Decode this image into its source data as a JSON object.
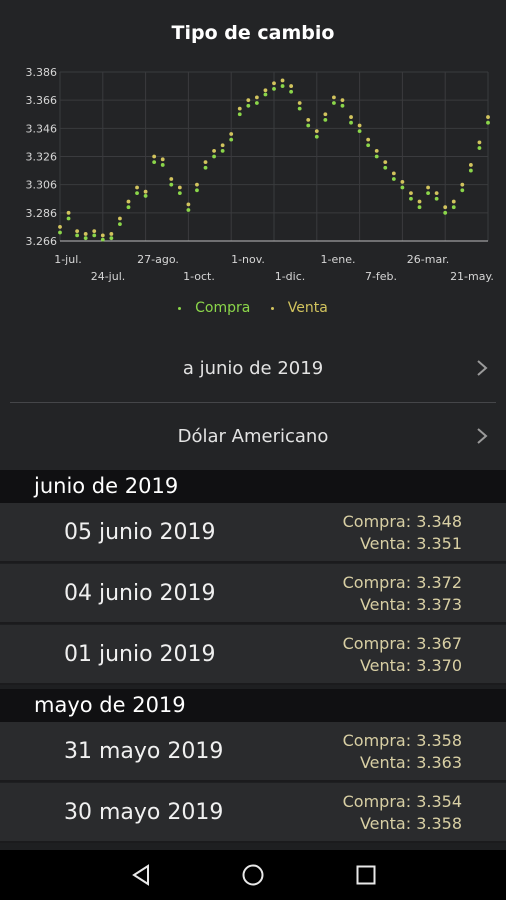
{
  "header": {
    "title": "Tipo de cambio"
  },
  "chart_data": {
    "type": "scatter",
    "ylim": [
      3.266,
      3.386
    ],
    "y_ticks": [
      "3.386",
      "3.366",
      "3.346",
      "3.326",
      "3.306",
      "3.286",
      "3.266"
    ],
    "x_ticks_top": [
      "1-jul.",
      "27-ago.",
      "1-nov.",
      "1-ene.",
      "26-mar."
    ],
    "x_ticks_bottom": [
      "24-jul.",
      "1-oct.",
      "1-dic.",
      "7-feb.",
      "21-may."
    ],
    "grid": true,
    "legend_position": "bottom-center",
    "colors": {
      "Compra": "#8bd64a",
      "Venta": "#d2c45e"
    },
    "series": [
      {
        "name": "Compra",
        "x": [
          0,
          2,
          4,
          6,
          8,
          10,
          12,
          14,
          16,
          18,
          20,
          22,
          24,
          26,
          28,
          30,
          32,
          34,
          36,
          38,
          40,
          42,
          44,
          46,
          48,
          50,
          52,
          54,
          56,
          58,
          60,
          62,
          64,
          66,
          68,
          70,
          72,
          74,
          76,
          78,
          80,
          82,
          84,
          86,
          88,
          90,
          92,
          94,
          96,
          98,
          100
        ],
        "values": [
          3.272,
          3.282,
          3.27,
          3.268,
          3.27,
          3.267,
          3.268,
          3.278,
          3.29,
          3.3,
          3.298,
          3.322,
          3.32,
          3.306,
          3.3,
          3.288,
          3.302,
          3.318,
          3.326,
          3.33,
          3.338,
          3.356,
          3.362,
          3.364,
          3.37,
          3.374,
          3.376,
          3.372,
          3.36,
          3.348,
          3.34,
          3.352,
          3.364,
          3.362,
          3.35,
          3.344,
          3.334,
          3.326,
          3.318,
          3.31,
          3.304,
          3.296,
          3.29,
          3.3,
          3.296,
          3.286,
          3.29,
          3.302,
          3.316,
          3.332,
          3.35
        ]
      },
      {
        "name": "Venta",
        "x": [
          0,
          2,
          4,
          6,
          8,
          10,
          12,
          14,
          16,
          18,
          20,
          22,
          24,
          26,
          28,
          30,
          32,
          34,
          36,
          38,
          40,
          42,
          44,
          46,
          48,
          50,
          52,
          54,
          56,
          58,
          60,
          62,
          64,
          66,
          68,
          70,
          72,
          74,
          76,
          78,
          80,
          82,
          84,
          86,
          88,
          90,
          92,
          94,
          96,
          98,
          100
        ],
        "values": [
          3.276,
          3.286,
          3.273,
          3.271,
          3.273,
          3.27,
          3.271,
          3.282,
          3.294,
          3.304,
          3.301,
          3.326,
          3.324,
          3.31,
          3.304,
          3.292,
          3.306,
          3.322,
          3.33,
          3.334,
          3.342,
          3.36,
          3.366,
          3.368,
          3.373,
          3.378,
          3.38,
          3.376,
          3.364,
          3.352,
          3.344,
          3.356,
          3.368,
          3.366,
          3.354,
          3.348,
          3.338,
          3.33,
          3.322,
          3.314,
          3.308,
          3.3,
          3.294,
          3.304,
          3.3,
          3.29,
          3.294,
          3.306,
          3.32,
          3.336,
          3.354
        ]
      }
    ]
  },
  "legend": {
    "compra_label": "Compra",
    "venta_label": "Venta"
  },
  "period_selector": {
    "label": "a junio de 2019"
  },
  "currency_selector": {
    "label": "Dólar Americano"
  },
  "sections": [
    {
      "header": "junio de 2019",
      "rows": [
        {
          "date": "05 junio 2019",
          "compra": "Compra: 3.348",
          "venta": "Venta: 3.351"
        },
        {
          "date": "04 junio 2019",
          "compra": "Compra: 3.372",
          "venta": "Venta: 3.373"
        },
        {
          "date": "01 junio 2019",
          "compra": "Compra: 3.367",
          "venta": "Venta: 3.370"
        }
      ]
    },
    {
      "header": "mayo de 2019",
      "rows": [
        {
          "date": "31 mayo 2019",
          "compra": "Compra: 3.358",
          "venta": "Venta: 3.363"
        },
        {
          "date": "30 mayo 2019",
          "compra": "Compra: 3.354",
          "venta": "Venta: 3.358"
        }
      ]
    }
  ],
  "navbar": {
    "back_icon": "back-triangle-icon",
    "home_icon": "home-circle-icon",
    "recents_icon": "recents-square-icon"
  }
}
